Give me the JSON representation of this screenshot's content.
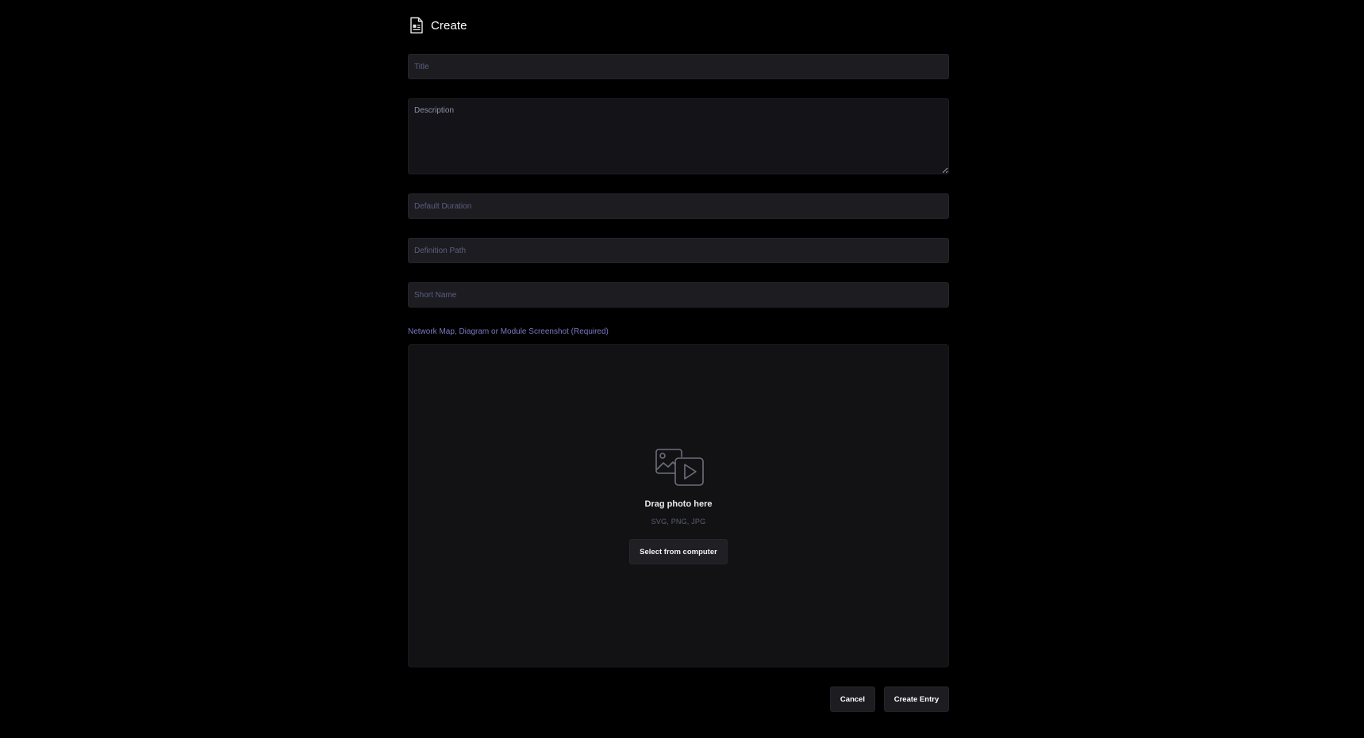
{
  "header": {
    "title": "Create",
    "icon": "document-icon"
  },
  "fields": {
    "title_placeholder": "Title",
    "description_placeholder": "Description",
    "default_duration_placeholder": "Default Duration",
    "definition_path_placeholder": "Definition Path",
    "short_name_placeholder": "Short Name"
  },
  "upload": {
    "label": "Network Map, Diagram or Module Screenshot (Required)",
    "title": "Drag photo here",
    "formats": "SVG, PNG, JPG",
    "select_label": "Select from computer",
    "icon": "image-video-icon"
  },
  "actions": {
    "cancel_label": "Cancel",
    "create_label": "Create Entry"
  },
  "colors": {
    "background": "#000000",
    "field_bg": "#1c1c21",
    "accent_label": "#7a78c0"
  }
}
